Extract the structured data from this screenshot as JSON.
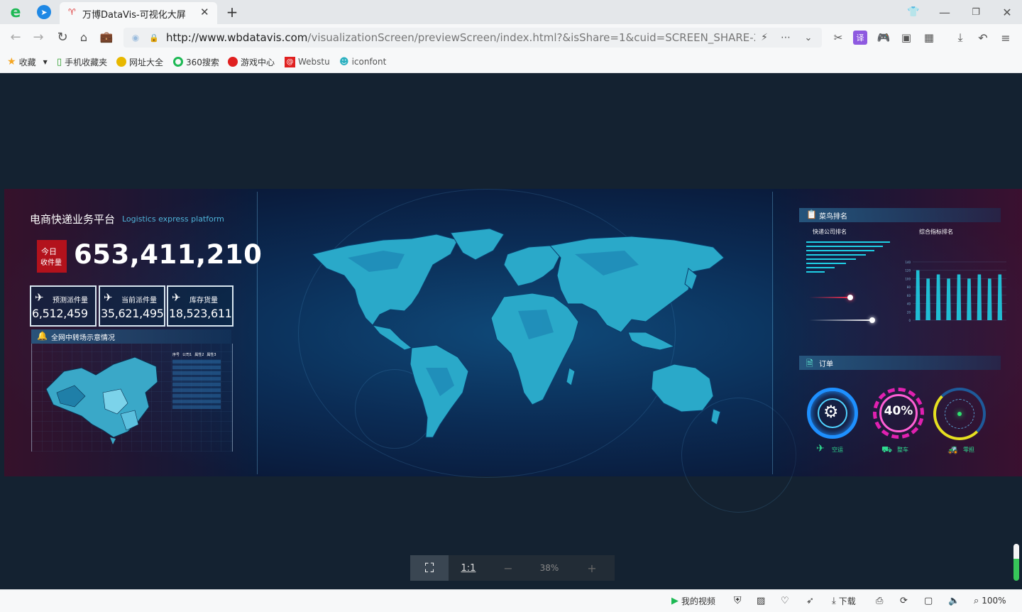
{
  "browser": {
    "tab_title": "万博DataVis-可视化大屏",
    "url_host": "http://www.wbdatavis.com",
    "url_path": "/visualizationScreen/previewScreen/index.html?&isShare=1&cuid=SCREEN_SHARE-2c9124d6871",
    "bookmarks": [
      "收藏",
      "手机收藏夹",
      "网址大全",
      "360搜索",
      "游戏中心",
      "Webstu",
      "iconfont"
    ],
    "status_items": [
      "我的视频",
      "下载",
      "100%"
    ]
  },
  "dashboard": {
    "title": "电商快递业务平台",
    "subtitle": "Logistics express platform",
    "today_label_line1": "今日",
    "today_label_line2": "收件量",
    "today_value": "653,411,210",
    "kpis": [
      {
        "label": "预测派件量",
        "value": "6,512,459"
      },
      {
        "label": "当前派件量",
        "value": "35,621,495"
      },
      {
        "label": "库存货量",
        "value": "18,523,611"
      }
    ],
    "map_section_title": "全网中转场示意情况",
    "table_headers": [
      "序号",
      "公司1",
      "属性2",
      "属性3"
    ],
    "rank_section_title": "菜鸟排名",
    "rank_left_title": "快递公司排名",
    "rank_right_title": "综合指标排名",
    "order_section_title": "订单",
    "gauge_center_label": "40%",
    "gauges": [
      {
        "label": "空运"
      },
      {
        "label": "整车"
      },
      {
        "label": "零担"
      }
    ],
    "zoom": {
      "fit": "⛶",
      "ratio": "1:1",
      "minus": "−",
      "value": "38%",
      "plus": "+"
    }
  },
  "chart_data": {
    "type": "bar",
    "title": "综合指标排名",
    "values": [
      120,
      100,
      110,
      100,
      110,
      100,
      110,
      100,
      110
    ],
    "ylim": [
      0,
      150
    ],
    "yticks": [
      0,
      20,
      40,
      60,
      80,
      100,
      120,
      140
    ]
  },
  "colors": {
    "accent": "#1fd0e6",
    "red_badge": "#b3121c",
    "map_fill": "#2aa9c9",
    "gauge_blue": "#1e90ff",
    "gauge_pink": "#e020b0",
    "gauge_yellow": "#e6e020"
  }
}
